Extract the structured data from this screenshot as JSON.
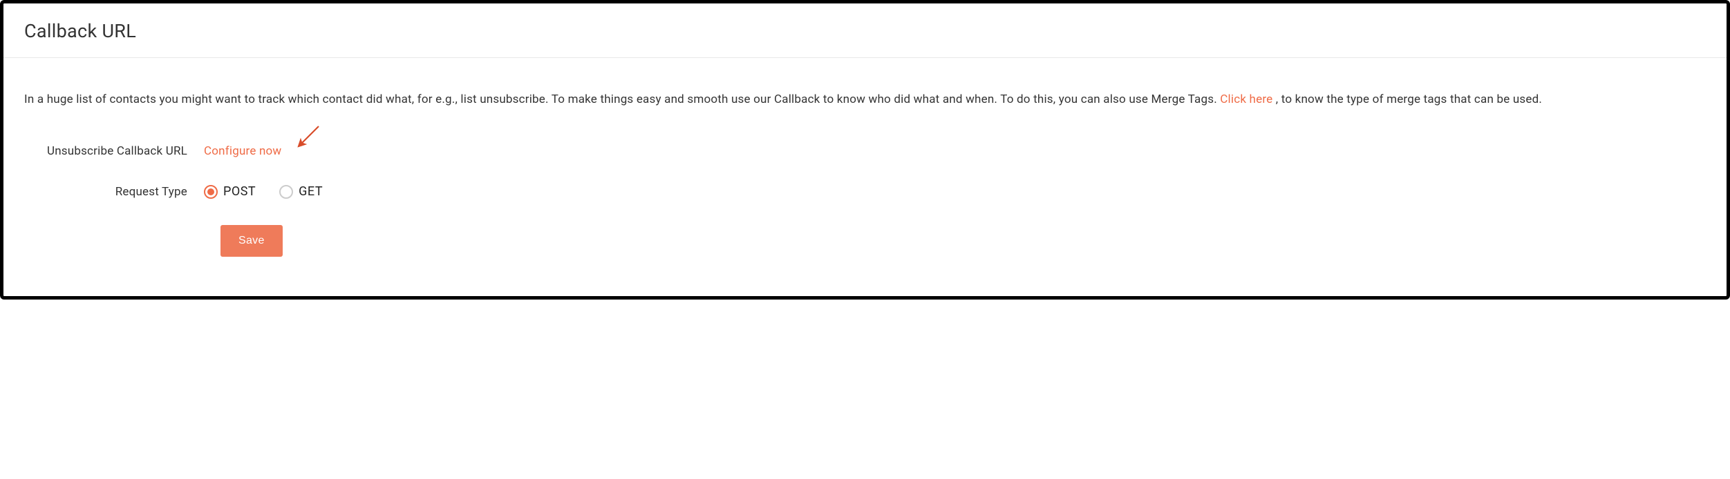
{
  "header": {
    "title": "Callback URL"
  },
  "description": {
    "text1": "In a huge list of contacts you might want to track which contact did what, for e.g., list unsubscribe. To make things easy and smooth use our Callback to know who did what and when. To do this, you can also use Merge Tags. ",
    "clickHere": "Click here",
    "text2": " , to know the type of merge tags that can be used."
  },
  "form": {
    "unsubscribeLabel": "Unsubscribe Callback URL",
    "configureNow": "Configure now",
    "requestTypeLabel": "Request Type",
    "options": {
      "post": "POST",
      "get": "GET"
    },
    "selected": "post",
    "saveLabel": "Save"
  }
}
